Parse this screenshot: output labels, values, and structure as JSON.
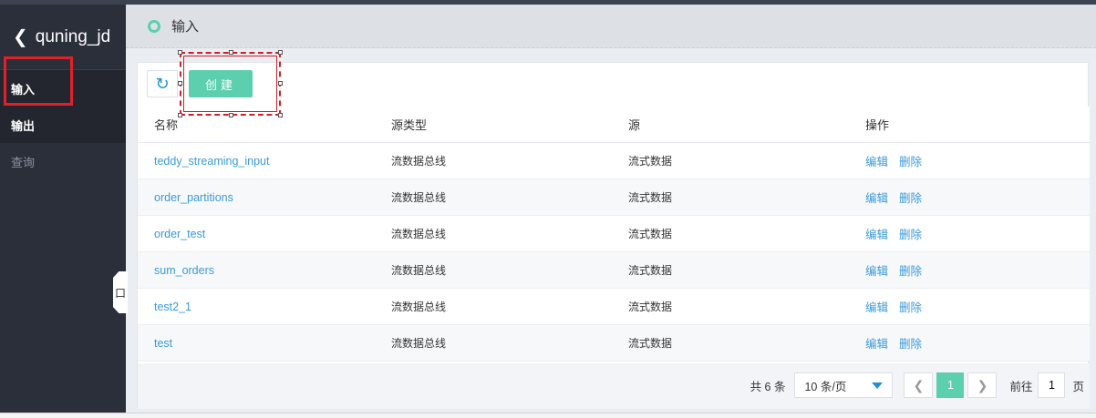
{
  "sidebar": {
    "project_name": "quning_jd",
    "items": [
      {
        "label": "输入"
      },
      {
        "label": "输出"
      },
      {
        "label": "查询"
      }
    ],
    "collapse_label": "口"
  },
  "header": {
    "title": "输入"
  },
  "toolbar": {
    "create_label": "创建"
  },
  "table": {
    "columns": [
      "名称",
      "源类型",
      "源",
      "操作"
    ],
    "rows": [
      {
        "name": "teddy_streaming_input",
        "source_type": "流数据总线",
        "source": "流式数据",
        "edit": "编辑",
        "delete": "删除"
      },
      {
        "name": "order_partitions",
        "source_type": "流数据总线",
        "source": "流式数据",
        "edit": "编辑",
        "delete": "删除"
      },
      {
        "name": "order_test",
        "source_type": "流数据总线",
        "source": "流式数据",
        "edit": "编辑",
        "delete": "删除"
      },
      {
        "name": "sum_orders",
        "source_type": "流数据总线",
        "source": "流式数据",
        "edit": "编辑",
        "delete": "删除"
      },
      {
        "name": "test2_1",
        "source_type": "流数据总线",
        "source": "流式数据",
        "edit": "编辑",
        "delete": "删除"
      },
      {
        "name": "test",
        "source_type": "流数据总线",
        "source": "流式数据",
        "edit": "编辑",
        "delete": "删除"
      }
    ]
  },
  "pagination": {
    "total": "共 6 条",
    "page_size": "10 条/页",
    "current_page": "1",
    "goto_label": "前往",
    "goto_value": "1",
    "page_unit": "页"
  },
  "colors": {
    "accent": "#5ccfae",
    "sidebar_bg": "#2b2f3a",
    "link": "#3a9ad9",
    "highlight_box": "#e0202a"
  }
}
